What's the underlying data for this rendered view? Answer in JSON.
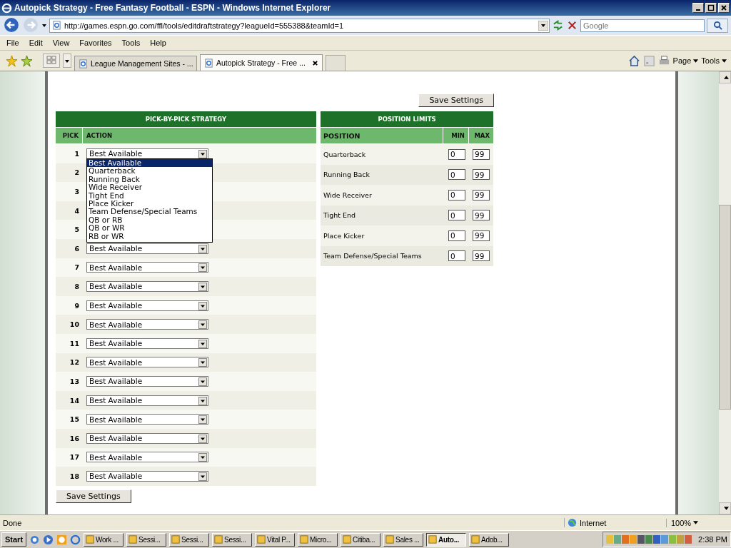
{
  "window": {
    "title": "Autopick Strategy - Free Fantasy Football - ESPN - Windows Internet Explorer"
  },
  "address_bar": {
    "url": "http://games.espn.go.com/ffl/tools/editdraftstrategy?leagueId=555388&teamId=1"
  },
  "search": {
    "placeholder": "Google"
  },
  "menu": [
    "File",
    "Edit",
    "View",
    "Favorites",
    "Tools",
    "Help"
  ],
  "tabs": [
    {
      "label": "League Management Sites - ...",
      "selected": false
    },
    {
      "label": "Autopick Strategy - Free ...",
      "selected": true
    }
  ],
  "command_bar": {
    "page": "Page",
    "tools": "Tools"
  },
  "save_button_top": "Save Settings",
  "strategy": {
    "title": "PICK-BY-PICK STRATEGY",
    "columns": [
      "PICK",
      "ACTION"
    ],
    "rows": [
      {
        "pick": "1",
        "action": "Best Available",
        "open": true
      },
      {
        "pick": "2"
      },
      {
        "pick": "3"
      },
      {
        "pick": "4"
      },
      {
        "pick": "5"
      },
      {
        "pick": "6",
        "action": "Best Available",
        "open": false
      },
      {
        "pick": "7",
        "action": "Best Available",
        "open": false
      },
      {
        "pick": "8",
        "action": "Best Available",
        "open": false
      },
      {
        "pick": "9",
        "action": "Best Available",
        "open": false
      },
      {
        "pick": "10",
        "action": "Best Available",
        "open": false
      },
      {
        "pick": "11",
        "action": "Best Available",
        "open": false
      },
      {
        "pick": "12",
        "action": "Best Available",
        "open": false
      },
      {
        "pick": "13",
        "action": "Best Available",
        "open": false
      },
      {
        "pick": "14",
        "action": "Best Available",
        "open": false
      },
      {
        "pick": "15",
        "action": "Best Available",
        "open": false
      },
      {
        "pick": "16",
        "action": "Best Available",
        "open": false
      },
      {
        "pick": "17",
        "action": "Best Available",
        "open": false
      },
      {
        "pick": "18",
        "action": "Best Available",
        "open": false
      }
    ],
    "options": [
      {
        "label": "Best Available",
        "selected": true
      },
      {
        "label": "Quarterback",
        "selected": false
      },
      {
        "label": "Running Back",
        "selected": false
      },
      {
        "label": "Wide Receiver",
        "selected": false
      },
      {
        "label": "Tight End",
        "selected": false
      },
      {
        "label": "Place Kicker",
        "selected": false
      },
      {
        "label": "Team Defense/Special Teams",
        "selected": false
      },
      {
        "label": "QB or RB",
        "selected": false
      },
      {
        "label": "QB or WR",
        "selected": false
      },
      {
        "label": "RB or WR",
        "selected": false
      }
    ]
  },
  "limits": {
    "title": "POSITION LIMITS",
    "columns": [
      "POSITION",
      "MIN",
      "MAX"
    ],
    "rows": [
      {
        "position": "Quarterback",
        "min": "0",
        "max": "99"
      },
      {
        "position": "Running Back",
        "min": "0",
        "max": "99"
      },
      {
        "position": "Wide Receiver",
        "min": "0",
        "max": "99"
      },
      {
        "position": "Tight End",
        "min": "0",
        "max": "99"
      },
      {
        "position": "Place Kicker",
        "min": "0",
        "max": "99"
      },
      {
        "position": "Team Defense/Special Teams",
        "min": "0",
        "max": "99"
      }
    ]
  },
  "save_button_bottom": "Save Settings",
  "status_bar": {
    "status": "Done",
    "zone": "Internet",
    "zoom": "100%"
  },
  "taskbar": {
    "start": "Start",
    "tasks": [
      {
        "label": "Work ...",
        "selected": false
      },
      {
        "label": "Sessi...",
        "selected": false
      },
      {
        "label": "Sessi...",
        "selected": false
      },
      {
        "label": "Sessi...",
        "selected": false
      },
      {
        "label": "Vital P...",
        "selected": false
      },
      {
        "label": "Micro...",
        "selected": false
      },
      {
        "label": "Citiba...",
        "selected": false
      },
      {
        "label": "Sales ...",
        "selected": false
      },
      {
        "label": "Auto...",
        "selected": true
      },
      {
        "label": "Adob...",
        "selected": false
      }
    ],
    "clock": "2:38 PM"
  }
}
